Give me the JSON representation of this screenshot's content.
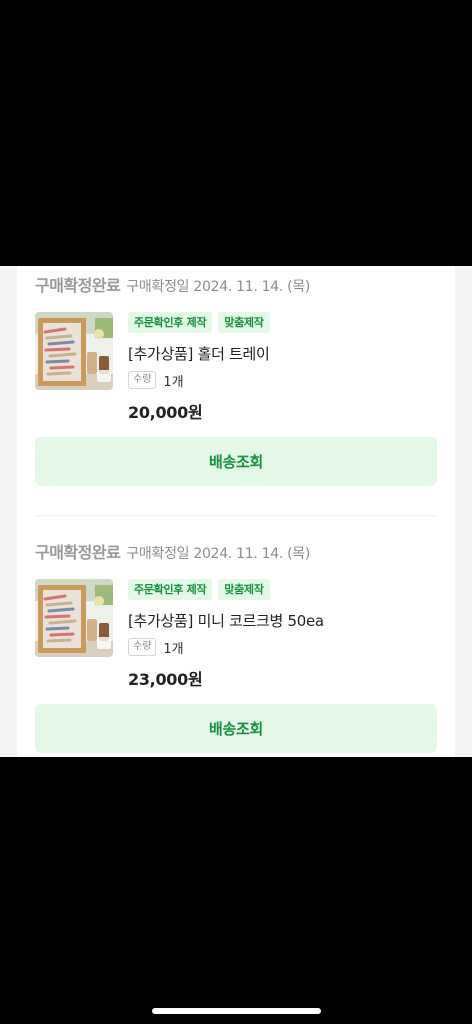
{
  "orders": [
    {
      "status": "구매확정완료",
      "date": "구매확정일 2024. 11. 14. (목)",
      "badges": [
        "주문확인후 제작",
        "맞춤제작"
      ],
      "title": "[추가상품] 홀더 트레이",
      "qty_label": "수량",
      "qty": "1개",
      "price": "20,000원",
      "button": "배송조회"
    },
    {
      "status": "구매확정완료",
      "date": "구매확정일 2024. 11. 14. (목)",
      "badges": [
        "주문확인후 제작",
        "맞춤제작"
      ],
      "title": "[추가상품] 미니 코르크병 50ea",
      "qty_label": "수량",
      "qty": "1개",
      "price": "23,000원",
      "button": "배송조회"
    }
  ],
  "colors": {
    "accent_green": "#17913f",
    "badge_bg": "#e4f8e8",
    "muted_text": "#9a9a9a"
  }
}
